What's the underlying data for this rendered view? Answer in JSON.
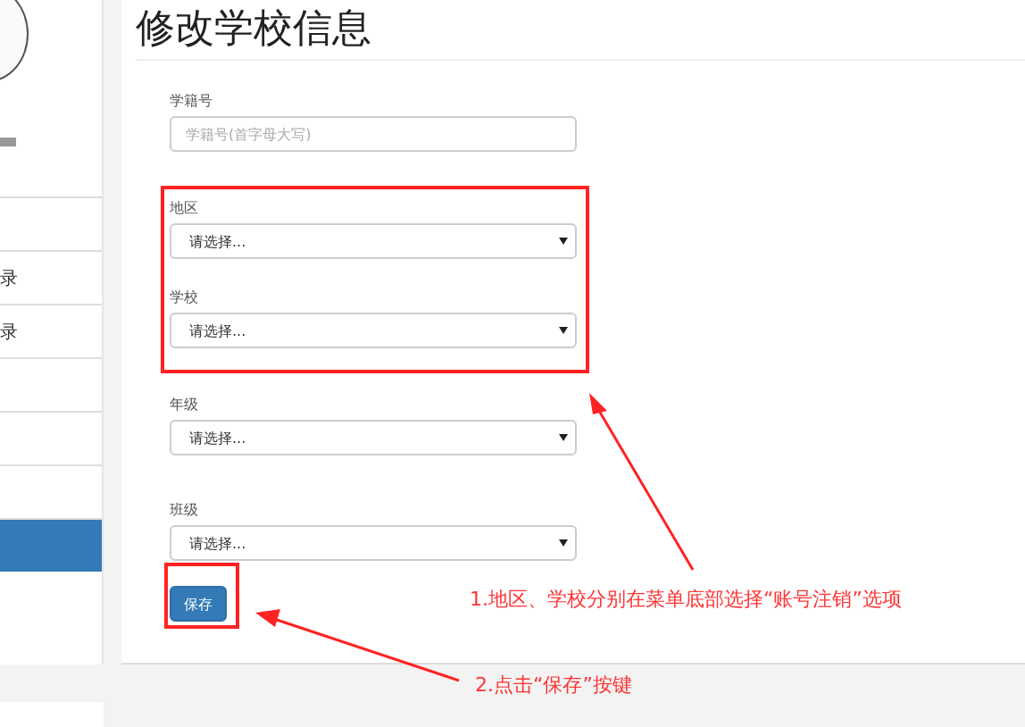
{
  "sidebar": {
    "items": [
      {
        "selected": false
      },
      {
        "label": "录",
        "selected": false
      },
      {
        "label": "录",
        "selected": false
      },
      {
        "selected": false
      },
      {
        "selected": false
      },
      {
        "selected": false
      },
      {
        "selected": true
      }
    ]
  },
  "title": "修改学校信息",
  "form": {
    "fields": [
      {
        "kind": "input",
        "label": "学籍号",
        "placeholder": "学籍号(首字母大写)"
      },
      {
        "kind": "select",
        "label": "地区",
        "value": "请选择..."
      },
      {
        "kind": "select",
        "label": "学校",
        "value": "请选择..."
      },
      {
        "kind": "select",
        "label": "年级",
        "value": "请选择..."
      },
      {
        "kind": "select",
        "label": "班级",
        "value": "请选择..."
      }
    ],
    "button": "保存"
  },
  "annotations": [
    {
      "text": "1.地区、学校分别在菜单底部选择“账号注销”选项"
    },
    {
      "text": "2.点击“保存”按键"
    }
  ]
}
